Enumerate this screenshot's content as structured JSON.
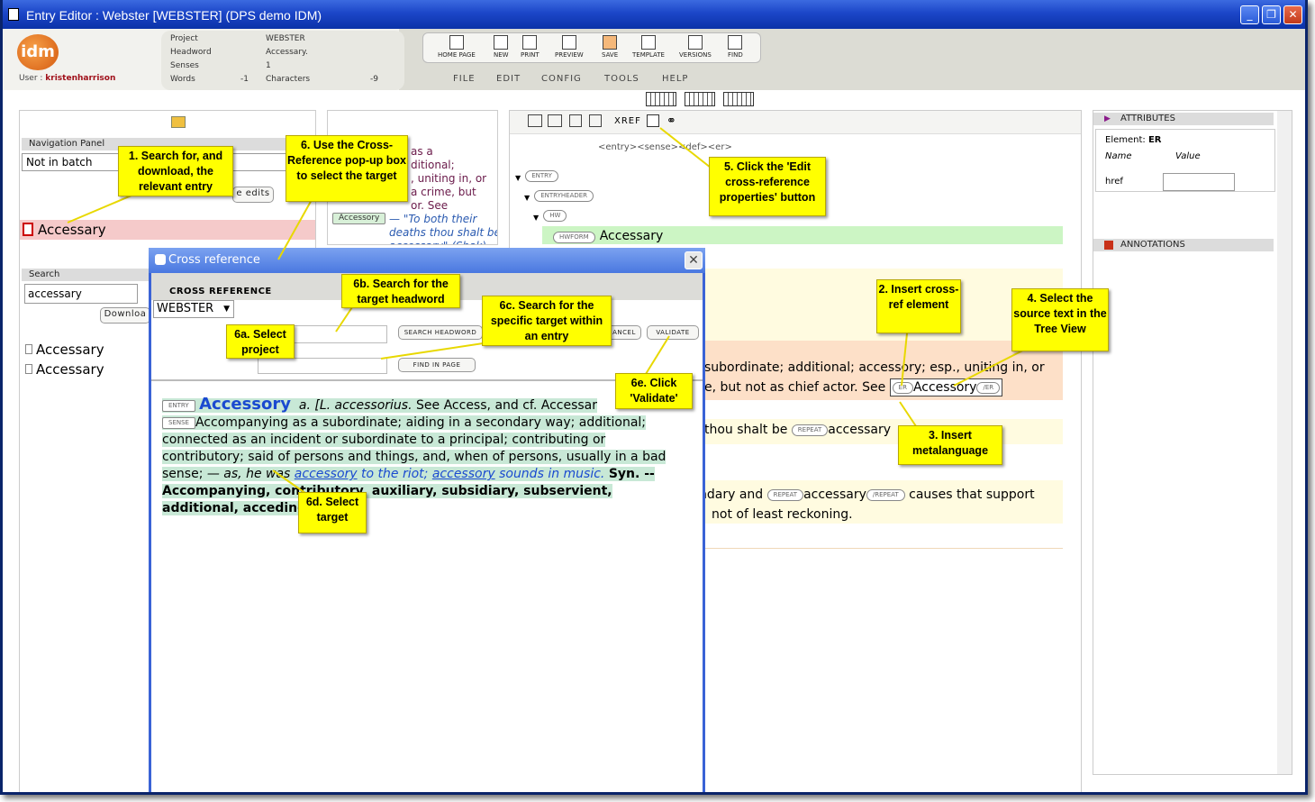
{
  "window": {
    "title": "Entry Editor : Webster [WEBSTER] (DPS demo IDM)"
  },
  "header": {
    "logo": "idm",
    "user_label": "User :",
    "user": "kristenharrison",
    "project_label": "Project",
    "project": "WEBSTER",
    "headword_label": "Headword",
    "headword": "Accessary.",
    "senses_label": "Senses",
    "senses": "1",
    "words_label": "Words",
    "words": "-1",
    "characters_label": "Characters",
    "characters": "-9"
  },
  "toolbar": [
    "HOME PAGE",
    "NEW",
    "PRINT",
    "PREVIEW",
    "SAVE",
    "TEMPLATE",
    "VERSIONS",
    "FIND"
  ],
  "menu": [
    "FILE",
    "EDIT",
    "CONFIG",
    "TOOLS",
    "HELP"
  ],
  "nav": {
    "title": "Navigation Panel",
    "batch": "Not in batch",
    "edits": "e edits",
    "item": "Accessary"
  },
  "search": {
    "title": "Search",
    "value": "accessary",
    "download": "Downloa",
    "results": [
      "Accessary",
      "Accessary"
    ]
  },
  "preview": {
    "text": "as a\nditional;\n, uniting in, or\na crime, but\nor. See",
    "ref": "Accessory",
    "quote": "— \"To both their\ndeaths thou shalt be\naccessary\" (Shak)"
  },
  "editor": {
    "xref": "XREF",
    "path": "<entry><sense><def><er>",
    "tree": [
      "ENTRY",
      "ENTRYHEADER",
      "HW",
      "HWFORM"
    ],
    "hw": "Accessary",
    "def1": "subordinate; additional; accessory; esp., uniting in, or",
    "def2": "e, but not as chief actor. See",
    "er_open": "ER",
    "er_text": "Accessory",
    "er_close": "/ER",
    "q1": "thou shalt be",
    "repeat": "REPEAT",
    "q1b": "accessary",
    "q2": "ndary and",
    "q2b": "accessary",
    "repeat_close": "/REPEAT",
    "q2c": "causes that support",
    "q3": "not of least reckoning."
  },
  "attributes": {
    "title": "ATTRIBUTES",
    "element_label": "Element:",
    "element": "ER",
    "name_col": "Name",
    "value_col": "Value",
    "href": "href"
  },
  "annotations": {
    "title": "ANNOTATIONS"
  },
  "dialog": {
    "title": "Cross reference",
    "section": "CROSS REFERENCE",
    "project": "WEBSTER",
    "search_headword": "SEARCH HEADWORD",
    "cancel": "ANCEL",
    "validate": "VALIDATE",
    "find_in_page": "FIND IN PAGE",
    "entry_tag": "ENTRY",
    "headword": "Accessory",
    "hw_rest": "a. [L.",
    "accessorius": "accessorius.",
    "see": "See",
    "access": "Access,",
    "andcf": "and cf.",
    "accessary": "Accessar",
    "sense_tag": "SENSE",
    "sense": "Accompanying as a subordinate; aiding in a secondary way; additional; connected as an incident or subordinate to a principal; contributing or contributory; said of persons and things, and, when of persons, usually in a bad sense;",
    "ex1": "— as, he was",
    "ex_link": "accessory",
    "ex2": "to the riot;",
    "ex_link2": "accessory",
    "ex3": "sounds in music.",
    "syn": "Syn. -- Accompanying, contributory, auxiliary, subsidiary, subservient, additional, acceding."
  },
  "notes": {
    "n1": "1. Search for, and download, the relevant entry",
    "n2": "2. Insert cross-ref element",
    "n3": "3. Insert metalanguage",
    "n4": "4. Select the source text in the Tree View",
    "n5": "5. Click the 'Edit cross-reference properties' button",
    "n6": "6. Use the Cross-Reference pop-up box to select the target",
    "n6a": "6a. Select project",
    "n6b": "6b. Search for the target headword",
    "n6c": "6c. Search for the specific target within an entry",
    "n6d": "6d. Select target",
    "n6e": "6e. Click 'Validate'"
  }
}
